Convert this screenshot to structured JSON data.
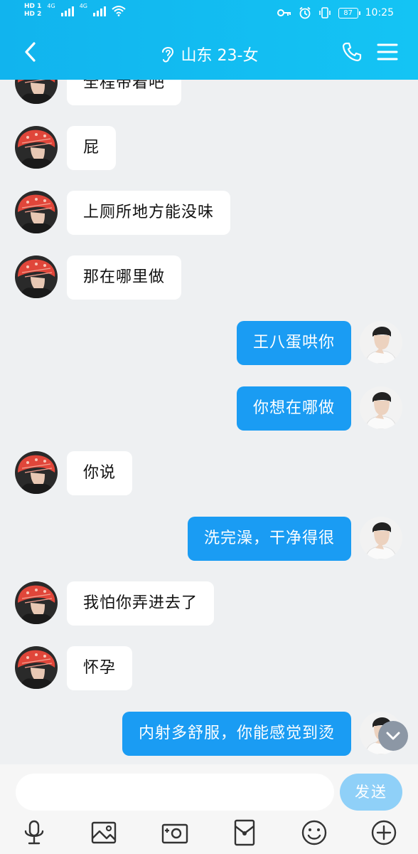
{
  "status_bar": {
    "sim1": "HD 1",
    "sim2": "HD 2",
    "net1": "4G",
    "net2": "4G",
    "battery": "87",
    "time": "10:25"
  },
  "header": {
    "title": "山东 23-女",
    "mode_icon": "ear-icon",
    "call_icon": "phone-icon",
    "menu_icon": "menu-icon"
  },
  "messages": [
    {
      "side": "in",
      "text": "全程带着吧"
    },
    {
      "side": "in",
      "text": "屁"
    },
    {
      "side": "in",
      "text": "上厕所地方能没味"
    },
    {
      "side": "in",
      "text": "那在哪里做"
    },
    {
      "side": "out",
      "text": "王八蛋哄你"
    },
    {
      "side": "out",
      "text": "你想在哪做"
    },
    {
      "side": "in",
      "text": "你说"
    },
    {
      "side": "out",
      "text": "洗完澡，干净得很"
    },
    {
      "side": "in",
      "text": "我怕你弄进去了"
    },
    {
      "side": "in",
      "text": "怀孕"
    },
    {
      "side": "out",
      "text": "内射多舒服，你能感觉到烫"
    }
  ],
  "composer": {
    "placeholder": "",
    "send_label": "发送"
  },
  "toolbar": [
    "voice-icon",
    "image-icon",
    "camera-icon",
    "red-packet-icon",
    "emoji-icon",
    "plus-icon"
  ],
  "colors": {
    "header": "#14bdf2",
    "outgoing_bubble": "#1a9cf3",
    "incoming_bubble": "#ffffff",
    "background": "#eef0f2",
    "send_button": "#8fd0f8"
  }
}
